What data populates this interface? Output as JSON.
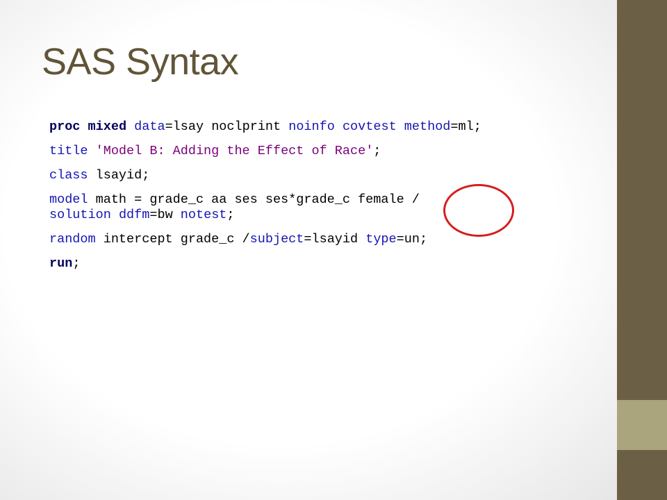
{
  "slide": {
    "title": "SAS Syntax"
  },
  "code": {
    "line1": {
      "proc": "proc",
      "mixed": "mixed",
      "data_kw": "data",
      "data_val": "=lsay noclprint ",
      "noinfo": "noinfo",
      "covtest": "covtest",
      "method_kw": "method",
      "method_val": "=ml;"
    },
    "line2": {
      "title_kw": "title",
      "title_str": "'Model B: Adding the Effect of Race'",
      "end": ";"
    },
    "line3": {
      "class_kw": "class",
      "class_val": " lsayid;"
    },
    "line4": {
      "model_kw": "model",
      "model_val": " math = grade_c aa ses ses*grade_c female /"
    },
    "line5": {
      "solution": "solution",
      "ddfm_kw": "ddfm",
      "ddfm_val": "=bw ",
      "notest": "notest",
      "end": ";"
    },
    "line6": {
      "random_kw": "random",
      "random_val": " intercept grade_c /",
      "subject_kw": "subject",
      "subject_val": "=lsayid ",
      "type_kw": "type",
      "type_val": "=un;"
    },
    "line7": {
      "run_kw": "run",
      "end": ";"
    }
  },
  "colors": {
    "title": "#615438",
    "sidebar": "#6b5f45",
    "sidebar_accent": "#aba57d",
    "keyword": "#1515b4",
    "bold_keyword": "#00005c",
    "string": "#7a007a",
    "highlight_circle": "#d51e1e"
  }
}
